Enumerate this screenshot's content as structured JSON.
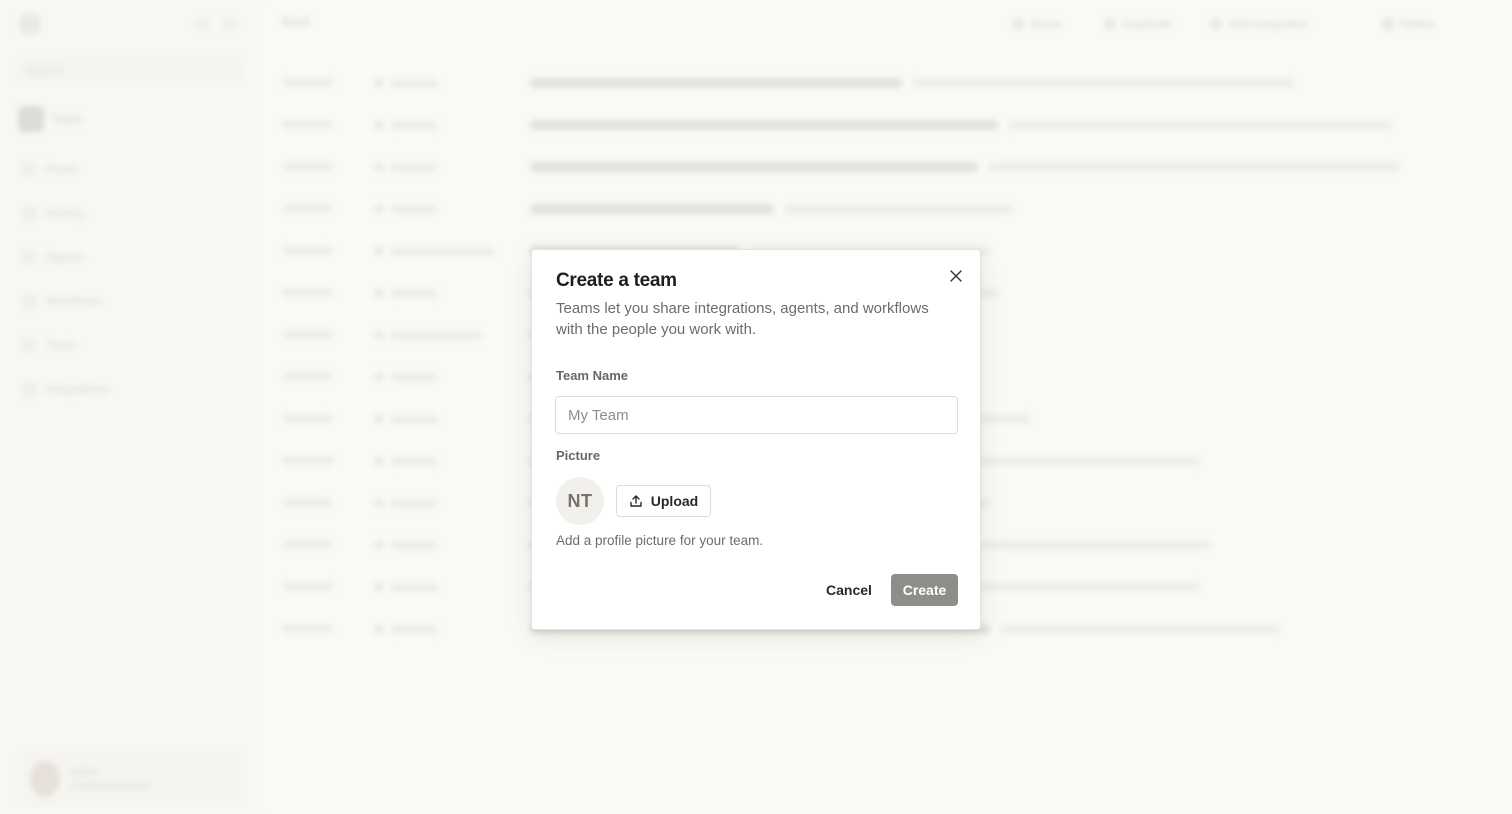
{
  "background": {
    "sidebar": {
      "search_placeholder": "Search",
      "team_label": "Team",
      "nav_items": [
        "Home",
        "Activity",
        "Agents",
        "Workflows",
        "Tasks",
        "Integrations"
      ]
    },
    "topbar": {
      "back_label": "Back",
      "buttons": [
        "Share",
        "Duplicate",
        "Add integration",
        "Delete"
      ]
    }
  },
  "dialog": {
    "title": "Create a team",
    "description": "Teams let you share integrations, agents, and workflows with the people you work with.",
    "team_name_label": "Team Name",
    "team_name_placeholder": "My Team",
    "team_name_value": "",
    "picture_label": "Picture",
    "avatar_initials": "NT",
    "upload_label": "Upload",
    "helper_text": "Add a profile picture for your team.",
    "cancel_label": "Cancel",
    "create_label": "Create"
  },
  "colors": {
    "page_bg": "#faf9f5",
    "create_button_disabled": "#8e8d89",
    "title_text": "#1f1e1b",
    "muted_text": "#6e6c66"
  },
  "icons": {
    "close": "close-icon",
    "upload": "upload-icon"
  }
}
